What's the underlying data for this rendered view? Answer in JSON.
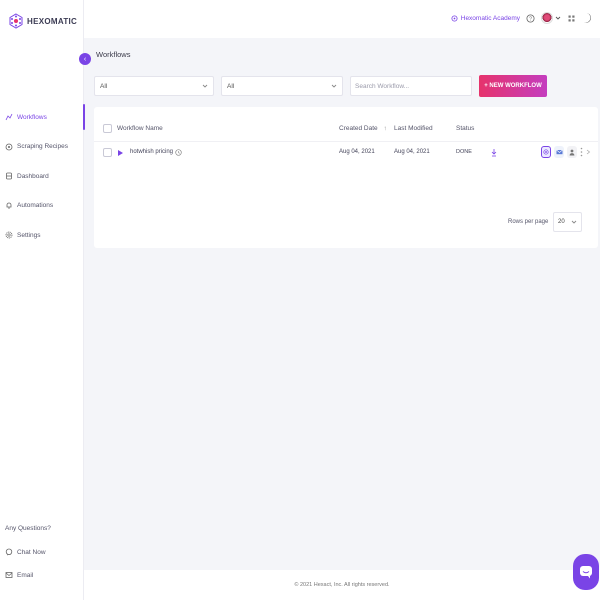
{
  "brand": {
    "name": "HEXOMATIC",
    "accent": "#7a44e6"
  },
  "sidebar": {
    "items": [
      {
        "label": "Workflows",
        "icon": "workflow-icon",
        "active": true
      },
      {
        "label": "Scraping Recipes",
        "icon": "recipe-icon",
        "active": false
      },
      {
        "label": "Dashboard",
        "icon": "dashboard-icon",
        "active": false
      },
      {
        "label": "Automations",
        "icon": "automation-icon",
        "active": false
      },
      {
        "label": "Settings",
        "icon": "gear-icon",
        "active": false
      }
    ],
    "help": {
      "title": "Any Questions?",
      "items": [
        {
          "label": "Chat Now",
          "icon": "chat-icon"
        },
        {
          "label": "Email",
          "icon": "email-icon"
        }
      ]
    }
  },
  "topbar": {
    "academy_label": "Hexomatic Academy"
  },
  "page": {
    "title": "Workflows"
  },
  "filters": {
    "filter1": "All",
    "filter2": "All",
    "search_placeholder": "Search Workflow...",
    "new_button": "+ NEW WORKFLOW"
  },
  "table": {
    "columns": [
      "Workflow Name",
      "Created Date",
      "Last Modified",
      "Status"
    ],
    "sort_indicator": "↑",
    "rows": [
      {
        "name": "hotwhish pricing",
        "created": "Aug 04, 2021",
        "modified": "Aug 04, 2021",
        "status": "DONE"
      }
    ],
    "rows_per_page_label": "Rows per page",
    "rows_per_page_value": "20"
  },
  "footer": {
    "copyright": "© 2021 Hexact, Inc. All rights reserved."
  }
}
